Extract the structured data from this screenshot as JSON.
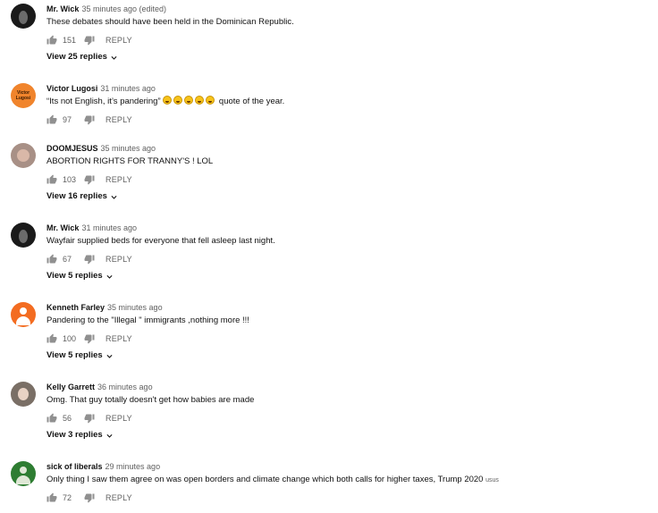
{
  "comments": [
    {
      "author": "Mr. Wick",
      "time": "35 minutes ago (edited)",
      "text": "These debates should have been held in the Dominican Republic.",
      "likes": "151",
      "reply": "REPLY",
      "view_replies": "View 25 replies"
    },
    {
      "author": "Victor Lugosi",
      "time": "31 minutes ago",
      "text_before": "“Its not English, it’s pandering”",
      "text_after": "quote of the year.",
      "avatar_text": "Victor Lugosi",
      "likes": "97",
      "reply": "REPLY"
    },
    {
      "author": "DOOMJESUS",
      "time": "35 minutes ago",
      "text": "ABORTION RIGHTS FOR TRANNY'S ! LOL",
      "likes": "103",
      "reply": "REPLY",
      "view_replies": "View 16 replies"
    },
    {
      "author": "Mr. Wick",
      "time": "31 minutes ago",
      "text": "Wayfair supplied beds for everyone that fell asleep last night.",
      "likes": "67",
      "reply": "REPLY",
      "view_replies": "View 5 replies"
    },
    {
      "author": "Kenneth Farley",
      "time": "35 minutes ago",
      "text": "Pandering to the \"Illegal \" immigrants ,nothing more !!!",
      "likes": "100",
      "reply": "REPLY",
      "view_replies": "View 5 replies"
    },
    {
      "author": "Kelly Garrett",
      "time": "36 minutes ago",
      "text": "Omg. That guy totally doesn't get how babies are made",
      "likes": "56",
      "reply": "REPLY",
      "view_replies": "View 3 replies"
    },
    {
      "author": "sick of liberals",
      "time": "29 minutes ago",
      "text": "Only thing I saw them agree on was open borders and climate change which both calls for higher taxes, Trump 2020",
      "text_suffix": "usus",
      "likes": "72",
      "reply": "REPLY"
    }
  ]
}
